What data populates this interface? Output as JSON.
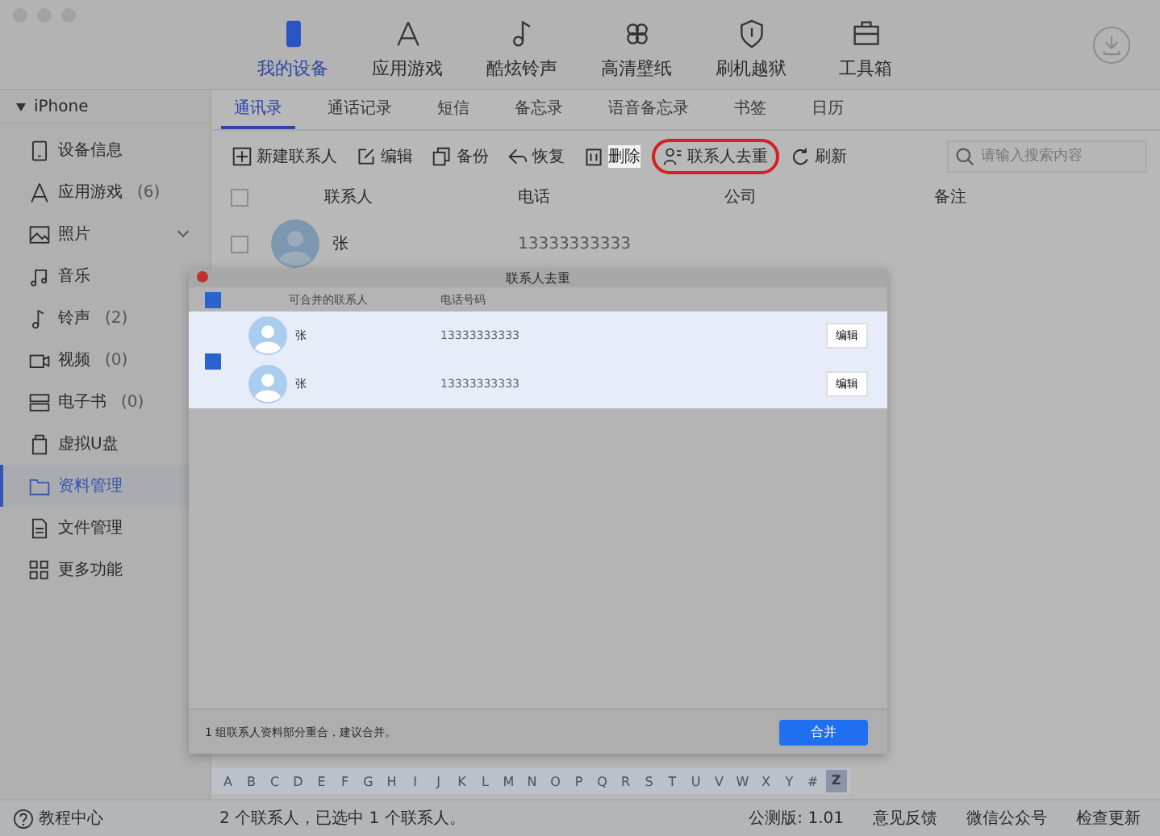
{
  "top_nav": [
    {
      "label": "我的设备",
      "selected": true
    },
    {
      "label": "应用游戏",
      "selected": false
    },
    {
      "label": "酷炫铃声",
      "selected": false
    },
    {
      "label": "高清壁纸",
      "selected": false
    },
    {
      "label": "刷机越狱",
      "selected": false
    },
    {
      "label": "工具箱",
      "selected": false
    }
  ],
  "sidebar": {
    "device": "iPhone",
    "expanded": true,
    "items": [
      {
        "label": "设备信息",
        "selected": false
      },
      {
        "label": "应用游戏",
        "count": "(6)",
        "selected": false
      },
      {
        "label": "照片",
        "expandable": true,
        "selected": false
      },
      {
        "label": "音乐",
        "selected": false
      },
      {
        "label": "铃声",
        "count": "(2)",
        "selected": false
      },
      {
        "label": "视频",
        "count": "(0)",
        "selected": false
      },
      {
        "label": "电子书",
        "count": "(0)",
        "selected": false
      },
      {
        "label": "虚拟U盘",
        "selected": false
      },
      {
        "label": "资料管理",
        "selected": true
      },
      {
        "label": "文件管理",
        "selected": false
      },
      {
        "label": "更多功能",
        "selected": false
      }
    ]
  },
  "tabs": [
    {
      "label": "通讯录",
      "selected": true
    },
    {
      "label": "通话记录",
      "selected": false
    },
    {
      "label": "短信",
      "selected": false
    },
    {
      "label": "备忘录",
      "selected": false
    },
    {
      "label": "语音备忘录",
      "selected": false
    },
    {
      "label": "书签",
      "selected": false
    },
    {
      "label": "日历",
      "selected": false
    }
  ],
  "toolbar": [
    {
      "label": "新建联系人",
      "circled": false,
      "highlighted": false
    },
    {
      "label": "编辑",
      "circled": false,
      "highlighted": false
    },
    {
      "label": "备份",
      "circled": false,
      "highlighted": false
    },
    {
      "label": "恢复",
      "circled": false,
      "highlighted": false
    },
    {
      "label": "删除",
      "circled": false,
      "highlighted": true
    },
    {
      "label": "联系人去重",
      "circled": true,
      "highlighted": false
    },
    {
      "label": "刷新",
      "circled": false,
      "highlighted": false
    }
  ],
  "search": {
    "placeholder": "请输入搜索内容"
  },
  "table": {
    "all_checked": false,
    "columns": [
      "联系人",
      "电话",
      "公司",
      "备注"
    ],
    "rows": [
      {
        "checked": false,
        "name": "张",
        "phone": "13333333333"
      }
    ]
  },
  "dialog": {
    "title": "联系人去重",
    "all_checked": true,
    "columns": [
      "可合并的联系人",
      "电话号码"
    ],
    "groups": [
      {
        "checked": true,
        "contacts": [
          {
            "name": "张",
            "phone": "13333333333",
            "action": "编辑"
          },
          {
            "name": "张",
            "phone": "13333333333",
            "action": "编辑"
          }
        ]
      }
    ],
    "message": "1 组联系人资料部分重合，建议合并。",
    "merge_button": "合并"
  },
  "alphabet": [
    {
      "letter": "A",
      "selected": false
    },
    {
      "letter": "B",
      "selected": false
    },
    {
      "letter": "C",
      "selected": false
    },
    {
      "letter": "D",
      "selected": false
    },
    {
      "letter": "E",
      "selected": false
    },
    {
      "letter": "F",
      "selected": false
    },
    {
      "letter": "G",
      "selected": false
    },
    {
      "letter": "H",
      "selected": false
    },
    {
      "letter": "I",
      "selected": false
    },
    {
      "letter": "J",
      "selected": false
    },
    {
      "letter": "K",
      "selected": false
    },
    {
      "letter": "L",
      "selected": false
    },
    {
      "letter": "M",
      "selected": false
    },
    {
      "letter": "N",
      "selected": false
    },
    {
      "letter": "O",
      "selected": false
    },
    {
      "letter": "P",
      "selected": false
    },
    {
      "letter": "Q",
      "selected": false
    },
    {
      "letter": "R",
      "selected": false
    },
    {
      "letter": "S",
      "selected": false
    },
    {
      "letter": "T",
      "selected": false
    },
    {
      "letter": "U",
      "selected": false
    },
    {
      "letter": "V",
      "selected": false
    },
    {
      "letter": "W",
      "selected": false
    },
    {
      "letter": "X",
      "selected": false
    },
    {
      "letter": "Y",
      "selected": false
    },
    {
      "letter": "#",
      "selected": false
    },
    {
      "letter": "Z",
      "selected": true
    }
  ],
  "status_bar": {
    "help": "教程中心",
    "summary": "2 个联系人，已选中 1 个联系人。",
    "version": "公测版: 1.01",
    "feedback": "意见反馈",
    "wechat": "微信公众号",
    "update": "检查更新"
  }
}
